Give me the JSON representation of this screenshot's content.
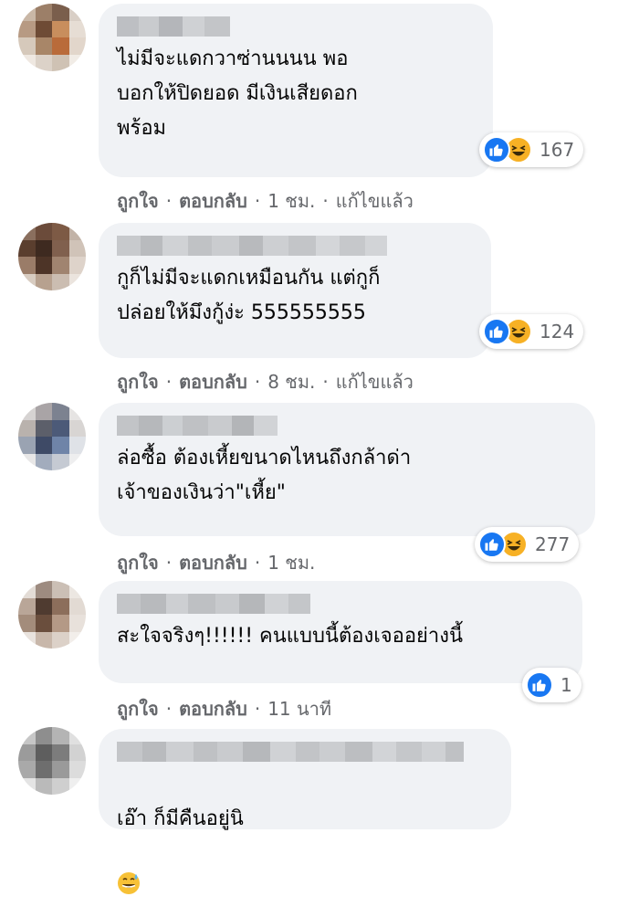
{
  "comments": [
    {
      "text": "ไม่มีจะแดกวาซ่านนนน พอ\nบอกให้ปิดยอด มีเงินเสียดอก\nพร้อม",
      "reaction_count": "167",
      "reactions": [
        "like",
        "haha"
      ],
      "actions": {
        "like": "ถูกใจ",
        "reply": "ตอบกลับ",
        "time": "1 ชม.",
        "edited": "แก้ไขแล้ว"
      }
    },
    {
      "text": "กูก็ไม่มีจะแดกเหมือนกัน แต่กูก็\nปล่อยให้มึงกู้ง่ะ 555555555",
      "reaction_count": "124",
      "reactions": [
        "like",
        "haha"
      ],
      "actions": {
        "like": "ถูกใจ",
        "reply": "ตอบกลับ",
        "time": "8 ชม.",
        "edited": "แก้ไขแล้ว"
      }
    },
    {
      "text": "ล่อซื้อ ต้องเหี้ยขนาดไหนถึงกล้าด่า\nเจ้าของเงินว่า\"เหี้ย\"",
      "reaction_count": "277",
      "reactions": [
        "like",
        "haha"
      ],
      "actions": {
        "like": "ถูกใจ",
        "reply": "ตอบกลับ",
        "time": "1 ชม."
      }
    },
    {
      "text": "สะใจจริงๆ!!!!!! คนแบบนี้ต้องเจออย่างนี้",
      "reaction_count": "1",
      "reactions": [
        "like"
      ],
      "actions": {
        "like": "ถูกใจ",
        "reply": "ตอบกลับ",
        "time": "11 นาที"
      }
    },
    {
      "text": "เอ๊า ก็มีคืนอยู่นิ",
      "reactions": [],
      "inline_emoji": "grinning-sweat-emoji"
    }
  ],
  "colors": {
    "bubble": "#f0f2f5",
    "like_blue": "#1877f2",
    "haha_yellow": "#f7b125",
    "meta_gray": "#65676b"
  }
}
